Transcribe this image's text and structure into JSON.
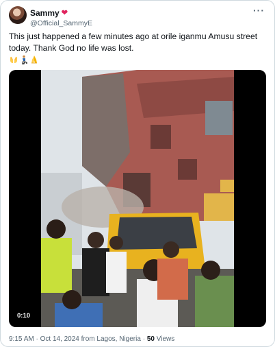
{
  "author": {
    "display_name": "Sammy",
    "handle": "@Official_SammyE",
    "badge_icon": "heart-icon",
    "badge_color": "#e0245e"
  },
  "tweet": {
    "text": "This just happened a few minutes ago at orile iganmu Amusu street today. Thank God no life was lost.",
    "emojis": [
      "open-hands-emoji",
      "kneeling-person-emoji",
      "folded-hands-emoji"
    ]
  },
  "media": {
    "type": "video",
    "duration": "0:10"
  },
  "meta": {
    "time": "9:15 AM",
    "separator": "·",
    "date": "Oct 14, 2024 from Lagos, Nigeria",
    "views_count": "50",
    "views_label": "Views"
  },
  "colors": {
    "text_primary": "#0f1419",
    "text_secondary": "#536471",
    "border": "#cfd9de"
  }
}
